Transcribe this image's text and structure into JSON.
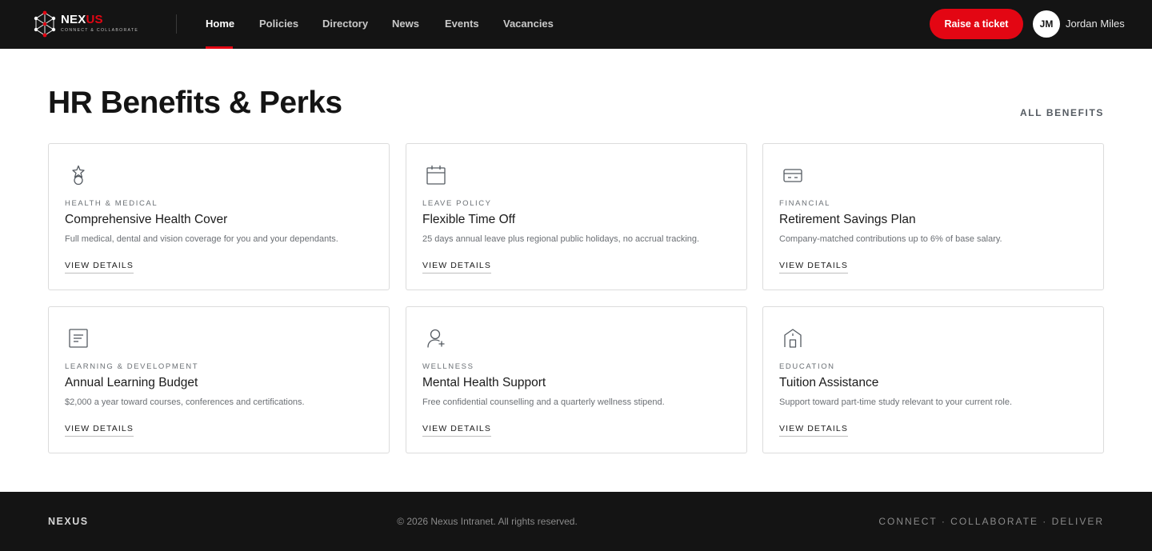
{
  "brand": {
    "name_part1": "NEX",
    "name_part2": "US",
    "tagline": "CONNECT & COLLABORATE",
    "accent_color": "#e30613"
  },
  "nav": {
    "items": [
      {
        "label": "Home",
        "active": true
      },
      {
        "label": "Policies",
        "active": false
      },
      {
        "label": "Directory",
        "active": false
      },
      {
        "label": "News",
        "active": false
      },
      {
        "label": "Events",
        "active": false
      },
      {
        "label": "Vacancies",
        "active": false
      }
    ]
  },
  "header": {
    "ticket_button": "Raise a ticket",
    "user_initials": "JM",
    "user_name": "Jordan Miles"
  },
  "main": {
    "title": "HR Benefits & Perks",
    "all_link": "ALL BENEFITS",
    "cards": [
      {
        "icon": "medal-icon",
        "category": "HEALTH & MEDICAL",
        "title": "Comprehensive Health Cover",
        "description": "Full medical, dental and vision coverage for you and your dependants.",
        "link": "VIEW DETAILS"
      },
      {
        "icon": "calendar-icon",
        "category": "LEAVE POLICY",
        "title": "Flexible Time Off",
        "description": "25 days annual leave plus regional public holidays, no accrual tracking.",
        "link": "VIEW DETAILS"
      },
      {
        "icon": "credit-card-icon",
        "category": "FINANCIAL",
        "title": "Retirement Savings Plan",
        "description": "Company-matched contributions up to 6% of base salary.",
        "link": "VIEW DETAILS"
      },
      {
        "icon": "document-icon",
        "category": "LEARNING & DEVELOPMENT",
        "title": "Annual Learning Budget",
        "description": "$2,000 a year toward courses, conferences and certifications.",
        "link": "VIEW DETAILS"
      },
      {
        "icon": "person-plus-icon",
        "category": "WELLNESS",
        "title": "Mental Health Support",
        "description": "Free confidential counselling and a quarterly wellness stipend.",
        "link": "VIEW DETAILS"
      },
      {
        "icon": "school-building-icon",
        "category": "EDUCATION",
        "title": "Tuition Assistance",
        "description": "Support toward part-time study relevant to your current role.",
        "link": "VIEW DETAILS"
      }
    ]
  },
  "footer": {
    "brand": "NEXUS",
    "copyright": "© 2026 Nexus Intranet. All rights reserved.",
    "tagline": "CONNECT · COLLABORATE · DELIVER"
  }
}
